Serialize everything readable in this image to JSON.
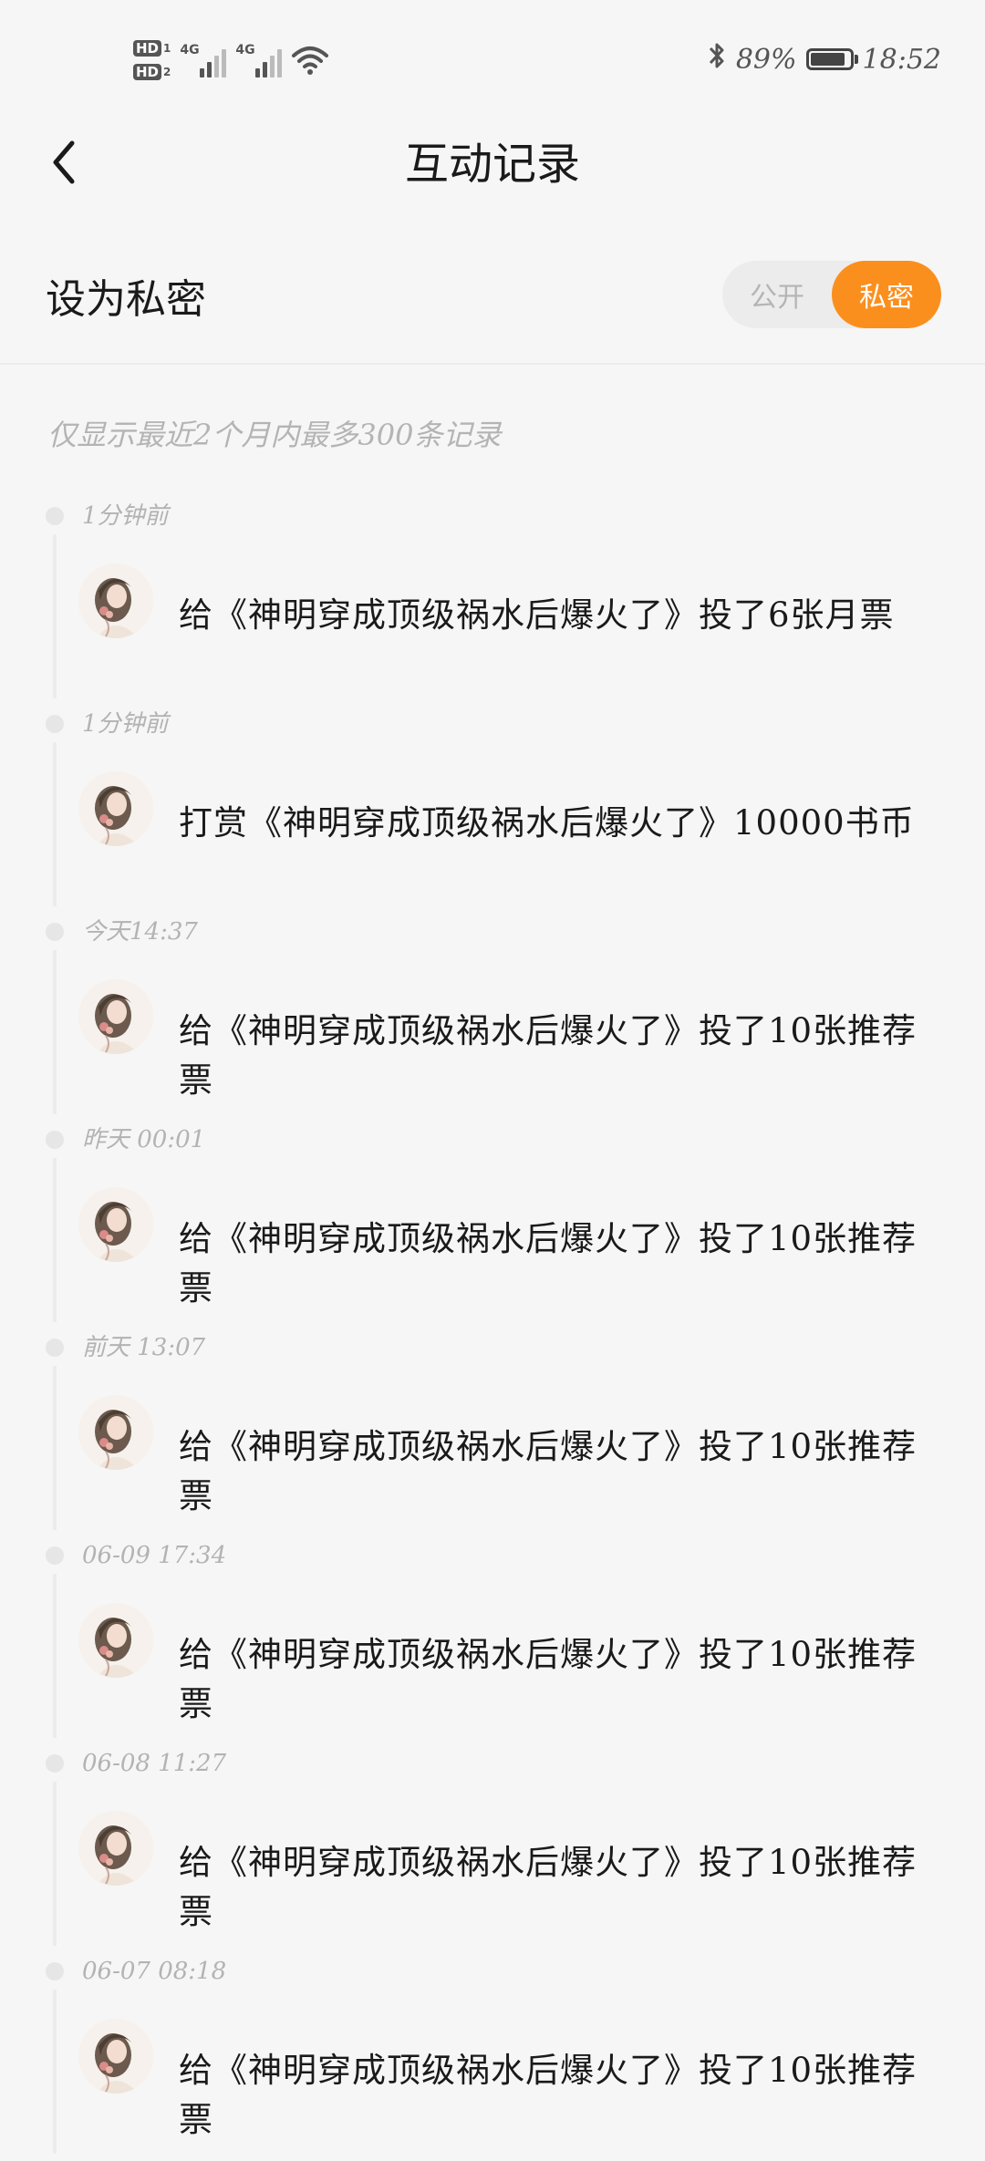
{
  "status_bar": {
    "hd1": "HD",
    "hd1_num": "1",
    "hd2": "HD",
    "hd2_num": "2",
    "net1": "4G",
    "net2": "4G",
    "battery_percent": "89%",
    "battery_level": 0.89,
    "time": "18:52",
    "icons": [
      "bluetooth-icon",
      "wifi-icon",
      "battery-icon",
      "signal-icon"
    ]
  },
  "header": {
    "title": "互动记录",
    "back_icon": "chevron-left-icon"
  },
  "privacy": {
    "label": "设为私密",
    "option_public": "公开",
    "option_private": "私密",
    "selected": "私密",
    "accent_color": "#fb8f1d"
  },
  "notice": "仅显示最近2个月内最多300条记录",
  "records": [
    {
      "time": "1分钟前",
      "text": "给《神明穿成顶级祸水后爆火了》投了6张月票"
    },
    {
      "time": "1分钟前",
      "text": "打赏《神明穿成顶级祸水后爆火了》10000书币"
    },
    {
      "time": "今天14:37",
      "text": "给《神明穿成顶级祸水后爆火了》投了10张推荐票"
    },
    {
      "time": "昨天 00:01",
      "text": "给《神明穿成顶级祸水后爆火了》投了10张推荐票"
    },
    {
      "time": "前天 13:07",
      "text": "给《神明穿成顶级祸水后爆火了》投了10张推荐票"
    },
    {
      "time": "06-09 17:34",
      "text": "给《神明穿成顶级祸水后爆火了》投了10张推荐票"
    },
    {
      "time": "06-08 11:27",
      "text": "给《神明穿成顶级祸水后爆火了》投了10张推荐票"
    },
    {
      "time": "06-07 08:18",
      "text": "给《神明穿成顶级祸水后爆火了》投了10张推荐票"
    }
  ]
}
